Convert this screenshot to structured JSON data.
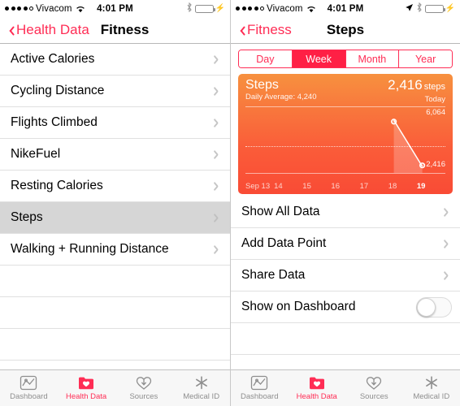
{
  "left": {
    "status": {
      "carrier": "Vivacom",
      "time": "4:01 PM",
      "signal_dots": 4,
      "signal_total": 5
    },
    "nav": {
      "back_label": "Health Data",
      "title": "Fitness"
    },
    "list": [
      {
        "label": "Active Calories",
        "selected": false
      },
      {
        "label": "Cycling Distance",
        "selected": false
      },
      {
        "label": "Flights Climbed",
        "selected": false
      },
      {
        "label": "NikeFuel",
        "selected": false
      },
      {
        "label": "Resting Calories",
        "selected": false
      },
      {
        "label": "Steps",
        "selected": true
      },
      {
        "label": "Walking + Running Distance",
        "selected": false
      }
    ]
  },
  "right": {
    "status": {
      "carrier": "Vivacom",
      "time": "4:01 PM",
      "signal_dots": 4,
      "signal_total": 5
    },
    "nav": {
      "back_label": "Fitness",
      "title": "Steps"
    },
    "segments": [
      {
        "label": "Day",
        "selected": false
      },
      {
        "label": "Week",
        "selected": true
      },
      {
        "label": "Month",
        "selected": false
      },
      {
        "label": "Year",
        "selected": false
      }
    ],
    "card": {
      "title": "Steps",
      "subtitle": "Daily Average: 4,240",
      "value": "2,416",
      "unit": "steps",
      "when": "Today"
    },
    "rows": [
      {
        "label": "Show All Data",
        "type": "chevron"
      },
      {
        "label": "Add Data Point",
        "type": "chevron"
      },
      {
        "label": "Share Data",
        "type": "chevron"
      },
      {
        "label": "Show on Dashboard",
        "type": "toggle",
        "toggle_on": false
      }
    ]
  },
  "chart_data": {
    "type": "line",
    "title": "Steps",
    "subtitle": "Daily Average: 4,240",
    "xlabel": "",
    "ylabel": "steps",
    "categories": [
      "Sep 13",
      "14",
      "15",
      "16",
      "17",
      "18",
      "19"
    ],
    "x": [
      "Sep 13",
      "14",
      "15",
      "16",
      "17",
      "18",
      "19"
    ],
    "values": [
      null,
      null,
      null,
      null,
      null,
      6064,
      2416
    ],
    "series": [
      {
        "name": "Steps",
        "values": [
          null,
          null,
          null,
          null,
          null,
          6064,
          2416
        ]
      }
    ],
    "ymax_label": "6,064",
    "ymin_label": "2,416",
    "ylim": [
      2416,
      6064
    ],
    "average_line": 4240,
    "average_line_label": "Daily Average: 4,240",
    "highlighted_category": "19",
    "highlighted_value": 2416,
    "grid": false,
    "legend": "none",
    "colors": {
      "fill_top": "#F7913F",
      "fill_bottom": "#F94B35",
      "line": "#FFFFFF"
    }
  },
  "tabs": [
    {
      "label": "Dashboard",
      "icon": "dashboard-chart-icon",
      "active": false
    },
    {
      "label": "Health Data",
      "icon": "health-folder-heart-icon",
      "active": true
    },
    {
      "label": "Sources",
      "icon": "sources-download-heart-icon",
      "active": false
    },
    {
      "label": "Medical ID",
      "icon": "medical-id-asterisk-icon",
      "active": false
    }
  ],
  "colors": {
    "accent": "#FF2D55",
    "selection": "#D6D6D6",
    "tab_inactive": "#8E8E8E"
  }
}
